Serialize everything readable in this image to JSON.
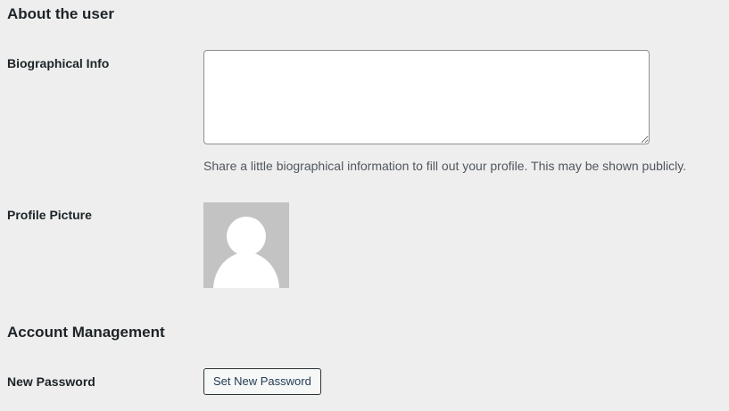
{
  "about_section": {
    "title": "About the user",
    "bio_label": "Biographical Info",
    "bio_value": "",
    "bio_description": "Share a little biographical information to fill out your profile. This may be shown publicly.",
    "profile_picture_label": "Profile Picture",
    "avatar_icon": "default-user-silhouette-icon"
  },
  "account_section": {
    "title": "Account Management",
    "new_password_label": "New Password",
    "set_password_button": "Set New Password"
  },
  "colors": {
    "background": "#eeeeee",
    "avatar_bg": "#c3c3c3",
    "button_text": "#1f3a52"
  }
}
